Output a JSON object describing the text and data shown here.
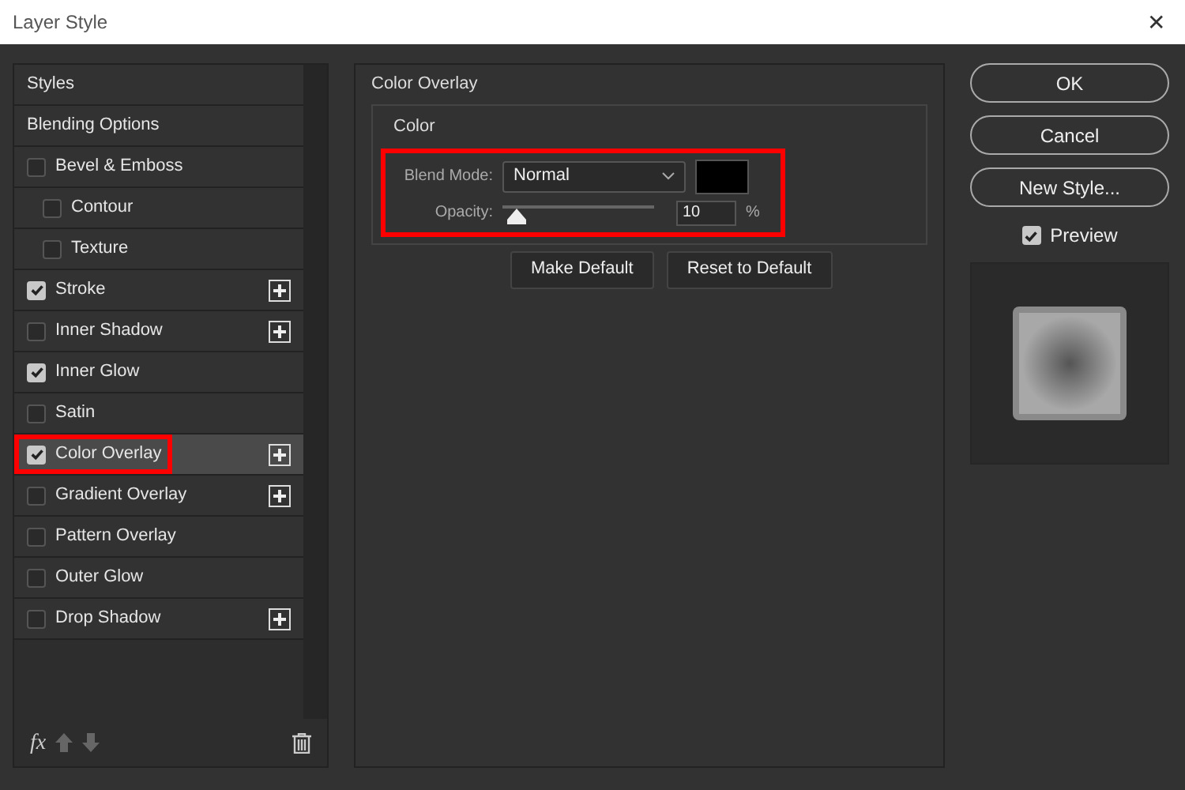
{
  "window": {
    "title": "Layer Style",
    "close": "✕"
  },
  "styles_list": [
    {
      "kind": "header",
      "label": "Styles",
      "selected": false
    },
    {
      "kind": "header",
      "label": "Blending Options",
      "selected": false
    },
    {
      "kind": "effect",
      "label": "Bevel & Emboss",
      "checked": false,
      "selected": false,
      "addable": false,
      "highlighted": false,
      "children": [
        {
          "kind": "effect",
          "label": "Contour",
          "checked": false,
          "selected": false,
          "addable": false,
          "highlighted": false
        },
        {
          "kind": "effect",
          "label": "Texture",
          "checked": false,
          "selected": false,
          "addable": false,
          "highlighted": false
        }
      ]
    },
    {
      "kind": "effect",
      "label": "Stroke",
      "checked": true,
      "selected": false,
      "addable": true,
      "highlighted": false
    },
    {
      "kind": "effect",
      "label": "Inner Shadow",
      "checked": false,
      "selected": false,
      "addable": true,
      "highlighted": false
    },
    {
      "kind": "effect",
      "label": "Inner Glow",
      "checked": true,
      "selected": false,
      "addable": false,
      "highlighted": false
    },
    {
      "kind": "effect",
      "label": "Satin",
      "checked": false,
      "selected": false,
      "addable": false,
      "highlighted": false
    },
    {
      "kind": "effect",
      "label": "Color Overlay",
      "checked": true,
      "selected": true,
      "addable": true,
      "highlighted": true
    },
    {
      "kind": "effect",
      "label": "Gradient Overlay",
      "checked": false,
      "selected": false,
      "addable": true,
      "highlighted": false
    },
    {
      "kind": "effect",
      "label": "Pattern Overlay",
      "checked": false,
      "selected": false,
      "addable": false,
      "highlighted": false
    },
    {
      "kind": "effect",
      "label": "Outer Glow",
      "checked": false,
      "selected": false,
      "addable": false,
      "highlighted": false
    },
    {
      "kind": "effect",
      "label": "Drop Shadow",
      "checked": false,
      "selected": false,
      "addable": true,
      "highlighted": false
    }
  ],
  "list_footer": {
    "fx": "fx"
  },
  "panel": {
    "title": "Color Overlay",
    "group": "Color",
    "highlighted": true,
    "blend_mode": {
      "label": "Blend Mode:",
      "value": "Normal",
      "color": "#000000"
    },
    "opacity": {
      "label": "Opacity:",
      "level": 0.03,
      "value": "10",
      "unit": "%"
    },
    "buttons": [
      "Make Default",
      "Reset to Default"
    ]
  },
  "actions": [
    "OK",
    "Cancel",
    "New Style..."
  ],
  "preview": {
    "label": "Preview",
    "checked": true
  }
}
